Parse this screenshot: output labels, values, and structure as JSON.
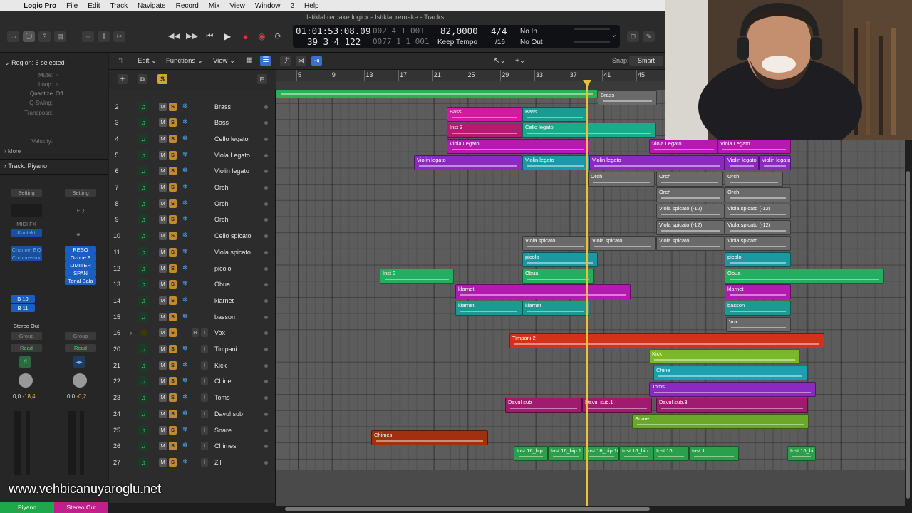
{
  "menubar": {
    "app": "Logic Pro",
    "items": [
      "File",
      "Edit",
      "Track",
      "Navigate",
      "Record",
      "Mix",
      "View",
      "Window",
      "2",
      "Help"
    ]
  },
  "window_title": "İstiklal remake.logicx - İstiklal remake - Tracks",
  "lcd": {
    "time": "01:01:53:08.09",
    "time_extra": "002 4 1 001",
    "bars": "39 3 4 122",
    "bars_extra": "0077 1 1 001",
    "tempo": "82,0000",
    "tempo_mode": "Keep Tempo",
    "signature": "4/4",
    "division": "/16",
    "in_label": "No In",
    "out_label": "No Out"
  },
  "inspector": {
    "region_title": "Region: 6 selected",
    "params": [
      {
        "k": "Mute:",
        "v": ""
      },
      {
        "k": "Loop:",
        "v": ""
      },
      {
        "k": "Quantize",
        "v": "Off"
      },
      {
        "k": "Q-Swing:",
        "v": ""
      },
      {
        "k": "Transpose:",
        "v": ""
      },
      {
        "k": "Velocity:",
        "v": ""
      }
    ],
    "more": "More",
    "track_title": "Track:",
    "track_name": "Piyano",
    "left_strip": {
      "setting": "Setting",
      "midifx": "MIDI FX",
      "instrument": "Kontakt",
      "inserts": [
        "Channel EQ",
        "Compressor"
      ],
      "sends": [
        "B 10",
        "B 11"
      ],
      "output": "Stereo Out",
      "group": "Group",
      "auto": "Read",
      "vol": "0,0",
      "peak": "-18,4",
      "name": "Piyano"
    },
    "right_strip": {
      "setting": "Setting",
      "eq": "EQ",
      "inserts": [
        "RESO",
        "Ozone 9",
        "LIMITER",
        "SPAN",
        "Tonal Bala"
      ],
      "group": "Group",
      "auto": "Read",
      "vol": "0,0",
      "peak": "-0,2",
      "name": "Stereo Out"
    }
  },
  "tracks_toolbar": {
    "edit": "Edit",
    "functions": "Functions",
    "view": "View",
    "snap_label": "Snap:",
    "snap_value": "Smart"
  },
  "ruler": [
    "5",
    "9",
    "13",
    "17",
    "21",
    "25",
    "29",
    "33",
    "37",
    "41",
    "45"
  ],
  "tracks": [
    {
      "num": "2",
      "name": "Brass"
    },
    {
      "num": "3",
      "name": "Bass"
    },
    {
      "num": "4",
      "name": "Cello legato"
    },
    {
      "num": "5",
      "name": "Viola Legato"
    },
    {
      "num": "6",
      "name": "Violin legato"
    },
    {
      "num": "7",
      "name": "Orch"
    },
    {
      "num": "8",
      "name": "Orch"
    },
    {
      "num": "9",
      "name": "Orch"
    },
    {
      "num": "10",
      "name": "Cello spicato"
    },
    {
      "num": "11",
      "name": "Viola spicato"
    },
    {
      "num": "12",
      "name": "picolo"
    },
    {
      "num": "13",
      "name": "Obua"
    },
    {
      "num": "14",
      "name": "klarnet"
    },
    {
      "num": "15",
      "name": "basson"
    },
    {
      "num": "16",
      "name": "Vox"
    },
    {
      "num": "20",
      "name": "Timpani"
    },
    {
      "num": "21",
      "name": "Kick"
    },
    {
      "num": "22",
      "name": "Chine"
    },
    {
      "num": "23",
      "name": "Toms"
    },
    {
      "num": "24",
      "name": "Davul sub"
    },
    {
      "num": "25",
      "name": "Snare"
    },
    {
      "num": "26",
      "name": "Chimes"
    },
    {
      "num": "27",
      "name": "Zil"
    }
  ],
  "regions": [
    {
      "label": "Bass",
      "color": "#d01aa0"
    },
    {
      "label": "Bass",
      "color": "#1a9a90"
    },
    {
      "label": "Inst 3",
      "color": "#b31a70"
    },
    {
      "label": "Cello legato",
      "color": "#1aab8a"
    },
    {
      "label": "Viola Legato",
      "color": "#b51ab0"
    },
    {
      "label": "Viola Legato",
      "color": "#b51ab0"
    },
    {
      "label": "Viola Legato",
      "color": "#b51ab0"
    },
    {
      "label": "Violin legato",
      "color": "#8a2ac0"
    },
    {
      "label": "Violin legato",
      "color": "#1a9aa8"
    },
    {
      "label": "Violin legato",
      "color": "#8a2ac0"
    },
    {
      "label": "Violin legato",
      "color": "#8a2ac0"
    },
    {
      "label": "Violin legato",
      "color": "#8a2ac0"
    },
    {
      "label": "Orch",
      "color": "#6a6a6a"
    },
    {
      "label": "Orch",
      "color": "#6a6a6a"
    },
    {
      "label": "Orch",
      "color": "#6a6a6a"
    },
    {
      "label": "Orch",
      "color": "#6a6a6a"
    },
    {
      "label": "Orch",
      "color": "#6a6a6a"
    },
    {
      "label": "Viola spicato (-12)",
      "color": "#6a6a6a"
    },
    {
      "label": "Viola spicato (-12)",
      "color": "#6a6a6a"
    },
    {
      "label": "Viola spicato (-12)",
      "color": "#6a6a6a"
    },
    {
      "label": "Viola spicato (-12)",
      "color": "#6a6a6a"
    },
    {
      "label": "Viola spicato",
      "color": "#6a6a6a"
    },
    {
      "label": "Viola spicato",
      "color": "#6a6a6a"
    },
    {
      "label": "Viola spicato",
      "color": "#6a6a6a"
    },
    {
      "label": "Viola spicato",
      "color": "#6a6a6a"
    },
    {
      "label": "picolo",
      "color": "#1a9aa0"
    },
    {
      "label": "picolo",
      "color": "#1a9aa0"
    },
    {
      "label": "Inst 2",
      "color": "#22b060"
    },
    {
      "label": "Obua",
      "color": "#22b060"
    },
    {
      "label": "Obua",
      "color": "#22b060"
    },
    {
      "label": "klarnet",
      "color": "#b31ab0"
    },
    {
      "label": "klarnet",
      "color": "#b31ab0"
    },
    {
      "label": "klarnet",
      "color": "#1a9a90"
    },
    {
      "label": "klarnet",
      "color": "#1a9a90"
    },
    {
      "label": "basson",
      "color": "#1a9a90"
    },
    {
      "label": "Vox",
      "color": "#6a6a6a"
    },
    {
      "label": "Timpani.2",
      "color": "#d0321a"
    },
    {
      "label": "Kick",
      "color": "#7ab82a"
    },
    {
      "label": "Chine",
      "color": "#1aa0b0"
    },
    {
      "label": "Toms",
      "color": "#8a2ac0"
    },
    {
      "label": "Davul sub",
      "color": "#a01a70"
    },
    {
      "label": "Davul sub.1",
      "color": "#a01a70"
    },
    {
      "label": "Davul sub.3",
      "color": "#a01a70"
    },
    {
      "label": "Snare",
      "color": "#6aa82a"
    },
    {
      "label": "Chimes",
      "color": "#a03010"
    },
    {
      "label": "Inst 16_bip",
      "color": "#2aa04a"
    },
    {
      "label": "Inst 16_bip.1",
      "color": "#2aa04a"
    },
    {
      "label": "Inst 16_bip.10",
      "color": "#2aa04a"
    },
    {
      "label": "Inst 16_bip.",
      "color": "#2aa04a"
    },
    {
      "label": "Inst 16",
      "color": "#2aa04a"
    },
    {
      "label": "Inst 1",
      "color": "#2aa04a"
    },
    {
      "label": "Inst 16_bi",
      "color": "#2aa04a"
    },
    {
      "label": "Brass",
      "color": "#6a6a6a"
    },
    {
      "label": "",
      "color": "#2ab050"
    }
  ],
  "watermark": "www.vehbicanuyaroglu.net"
}
